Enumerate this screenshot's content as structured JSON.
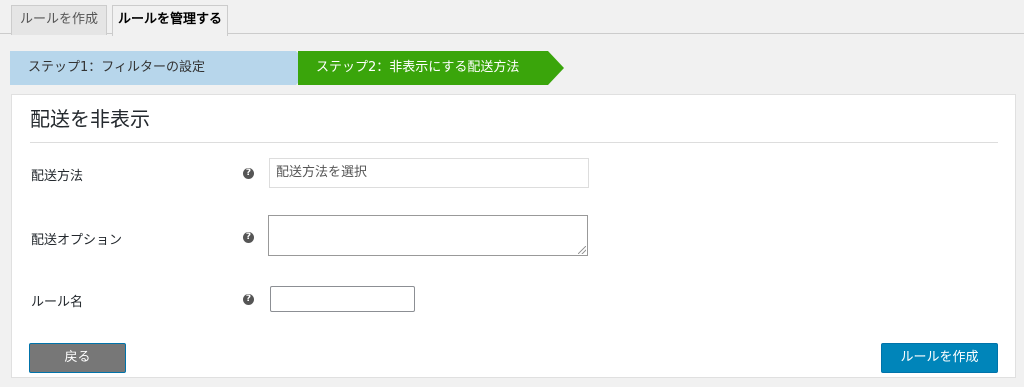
{
  "tabs": [
    {
      "label": "ルールを作成",
      "active": false
    },
    {
      "label": "ルールを管理する",
      "active": true
    }
  ],
  "steps": [
    {
      "label": "ステップ1：フィルターの設定",
      "color": "#b7d6eb"
    },
    {
      "label": "ステップ2：非表示にする配送方法",
      "color": "#3aa50b"
    }
  ],
  "panel": {
    "title": "配送を非表示",
    "fields": [
      {
        "label": "配送方法",
        "placeholder": "配送方法を選択"
      },
      {
        "label": "配送オプション",
        "value": ""
      },
      {
        "label": "ルール名",
        "value": ""
      }
    ],
    "help_icon_glyph": "?",
    "back_label": "戻る",
    "create_label": "ルールを作成"
  },
  "colors": {
    "accent": "#0085ba",
    "step_active": "#3aa50b",
    "step_inactive": "#b7d6eb",
    "back_button": "#777777"
  }
}
